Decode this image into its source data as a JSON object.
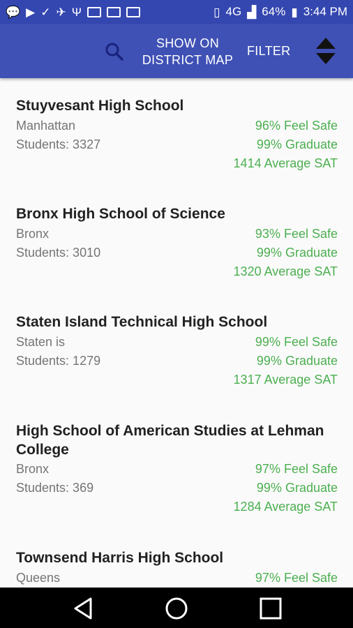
{
  "status_bar": {
    "battery": "64%",
    "time": "3:44 PM",
    "network": "4G"
  },
  "app_bar": {
    "search_icon": "search-icon",
    "map_label_line1": "SHOW ON",
    "map_label_line2": "DISTRICT MAP",
    "filter_label": "FILTER",
    "sort_icon": "sort-icon"
  },
  "schools": [
    {
      "name": "Stuyvesant High School",
      "borough": "Manhattan",
      "students": "Students: 3327",
      "feel_safe": "96% Feel Safe",
      "graduate": "99% Graduate",
      "sat": "1414 Average SAT"
    },
    {
      "name": "Bronx High School of Science",
      "borough": "Bronx",
      "students": "Students: 3010",
      "feel_safe": "93% Feel Safe",
      "graduate": "99% Graduate",
      "sat": "1320 Average SAT"
    },
    {
      "name": "Staten Island Technical High School",
      "borough": "Staten is",
      "students": "Students: 1279",
      "feel_safe": "99% Feel Safe",
      "graduate": "99% Graduate",
      "sat": "1317 Average SAT"
    },
    {
      "name": "High School of American Studies at Lehman College",
      "borough": "Bronx",
      "students": "Students: 369",
      "feel_safe": "97% Feel Safe",
      "graduate": "99% Graduate",
      "sat": "1284 Average SAT"
    },
    {
      "name": "Townsend Harris High School",
      "borough": "Queens",
      "students": "",
      "feel_safe": "97% Feel Safe",
      "graduate": "",
      "sat": ""
    }
  ],
  "colors": {
    "primary": "#3f51b5",
    "primary_dark": "#3447b0",
    "stat_green": "#4caf50"
  }
}
